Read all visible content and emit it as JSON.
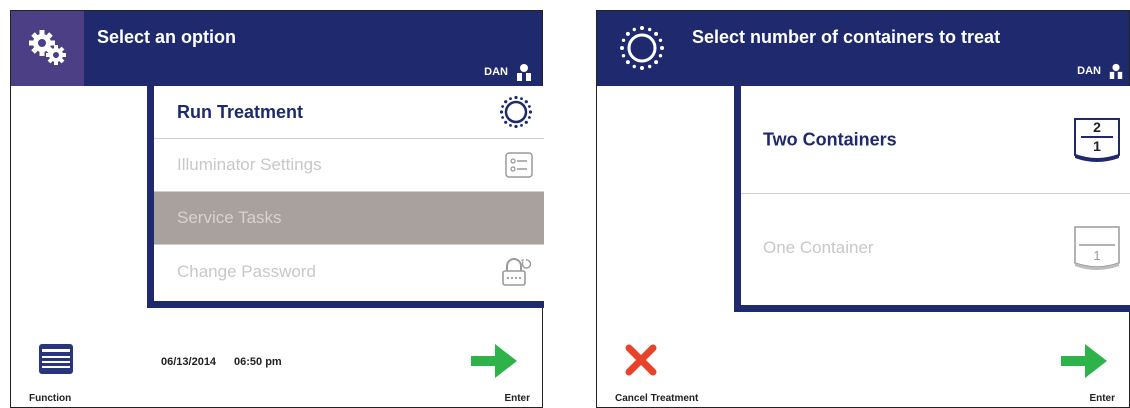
{
  "left_screen": {
    "header": {
      "title": "Select an option",
      "user": "DAN"
    },
    "menu": [
      {
        "label": "Run Treatment",
        "state": "active",
        "icon": "sun-dots-icon"
      },
      {
        "label": "Illuminator Settings",
        "state": "disabled",
        "icon": "settings-list-icon"
      },
      {
        "label": "Service Tasks",
        "state": "selected",
        "icon": ""
      },
      {
        "label": "Change Password",
        "state": "disabled",
        "icon": "lock-refresh-icon"
      }
    ],
    "footer": {
      "function_label": "Function",
      "date": "06/13/2014",
      "time": "06:50 pm",
      "enter_label": "Enter"
    }
  },
  "right_screen": {
    "header": {
      "title": "Select number of containers to treat",
      "user": "DAN"
    },
    "options": [
      {
        "label": "Two Containers",
        "state": "active",
        "icon": "two-containers-icon",
        "top": "2",
        "bottom": "1"
      },
      {
        "label": "One Container",
        "state": "disabled",
        "icon": "one-container-icon",
        "top": "",
        "bottom": "1"
      }
    ],
    "footer": {
      "cancel_label": "Cancel Treatment",
      "enter_label": "Enter"
    }
  },
  "colors": {
    "header_navy": "#1f2a6e",
    "logo_purple": "#4d3f86",
    "selected_gray": "#a8a19d",
    "enter_green": "#2db34a",
    "cancel_red": "#e8432a"
  }
}
